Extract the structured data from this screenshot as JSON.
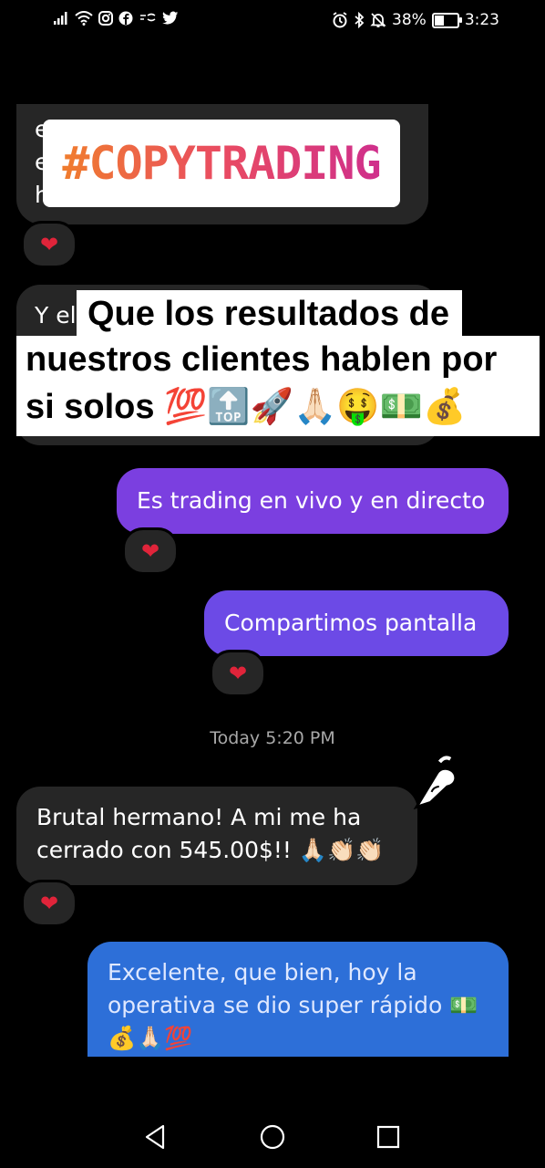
{
  "status_bar": {
    "left_icons": [
      "signal-icon",
      "wifi-icon",
      "instagram-icon",
      "facebook-icon",
      "app-icon",
      "twitter-icon"
    ],
    "battery_percent": "38%",
    "battery_level": 0.38,
    "time": "3:23",
    "right_icons": [
      "alarm-icon",
      "bluetooth-icon",
      "mute-icon",
      "battery-icon"
    ]
  },
  "sticker": {
    "hashtag": "#COPYTRADING"
  },
  "caption": {
    "line1": "Que los resultados de",
    "line2": "nuestros clientes hablen por",
    "line3": "si solos  💯🔝🚀🙏🏻🤑💵💰"
  },
  "messages": [
    {
      "id": "m1",
      "side": "received",
      "partial_text": "e  e  h",
      "reaction": "❤"
    },
    {
      "id": "m2",
      "side": "received",
      "partial_text": "Y el",
      "reaction": ""
    },
    {
      "id": "m3",
      "side": "sent",
      "text": "Es trading en vivo y en directo",
      "reaction": "❤"
    },
    {
      "id": "m4",
      "side": "sent",
      "text": "Compartimos pantalla",
      "reaction": "❤"
    },
    {
      "id": "m5",
      "side": "received",
      "text": "Brutal hermano! A mi me ha cerrado con 545.00$!! 🙏🏻👏🏻👏🏻",
      "line1": "Brutal hermano! A mi me ha",
      "line2": "cerrado con 545.00$!! 🙏🏻👏🏻👏🏻",
      "reaction": "❤"
    },
    {
      "id": "m6",
      "side": "sent",
      "line1": "Excelente, que bien, hoy la",
      "line2": "operativa se dio super rápido 💵",
      "line3": "💰🙏🏻💯"
    }
  ],
  "timestamp": "Today 5:20 PM",
  "colors": {
    "sent_purple": "#7b3fe0",
    "sent_blue": "#2d6fd8",
    "received": "#262626",
    "heart": "#e0243a",
    "hashtag_gradient": [
      "#f07d2e",
      "#e94b62",
      "#cf2f8c"
    ]
  },
  "nav": {
    "icons": [
      "back-icon",
      "home-icon",
      "recents-icon"
    ]
  }
}
